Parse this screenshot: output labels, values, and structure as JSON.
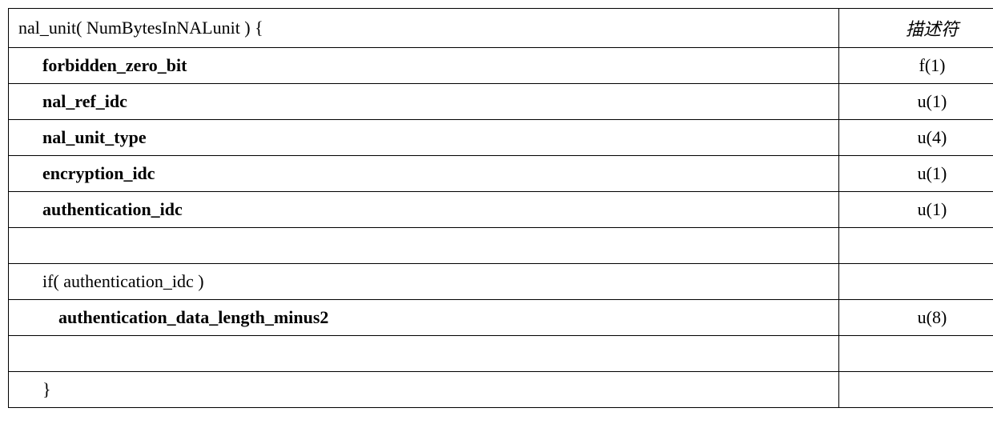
{
  "header": {
    "syntax": "nal_unit( NumBytesInNALunit ) {",
    "descriptor_label": "描述符"
  },
  "rows": [
    {
      "syntax": "forbidden_zero_bit",
      "descriptor": "f(1)",
      "bold": true,
      "indent": 1
    },
    {
      "syntax": "nal_ref_idc",
      "descriptor": "u(1)",
      "bold": true,
      "indent": 1
    },
    {
      "syntax": "nal_unit_type",
      "descriptor": "u(4)",
      "bold": true,
      "indent": 1
    },
    {
      "syntax": "encryption_idc",
      "descriptor": "u(1)",
      "bold": true,
      "indent": 1
    },
    {
      "syntax": "authentication_idc",
      "descriptor": "u(1)",
      "bold": true,
      "indent": 1
    },
    {
      "syntax": "",
      "descriptor": "",
      "bold": false,
      "indent": 0
    },
    {
      "syntax": "if( authentication_idc )",
      "descriptor": "",
      "bold": false,
      "indent": 1
    },
    {
      "syntax": "authentication_data_length_minus2",
      "descriptor": "u(8)",
      "bold": true,
      "indent": 2
    },
    {
      "syntax": "",
      "descriptor": "",
      "bold": false,
      "indent": 0
    }
  ],
  "footer": {
    "syntax": "}"
  }
}
